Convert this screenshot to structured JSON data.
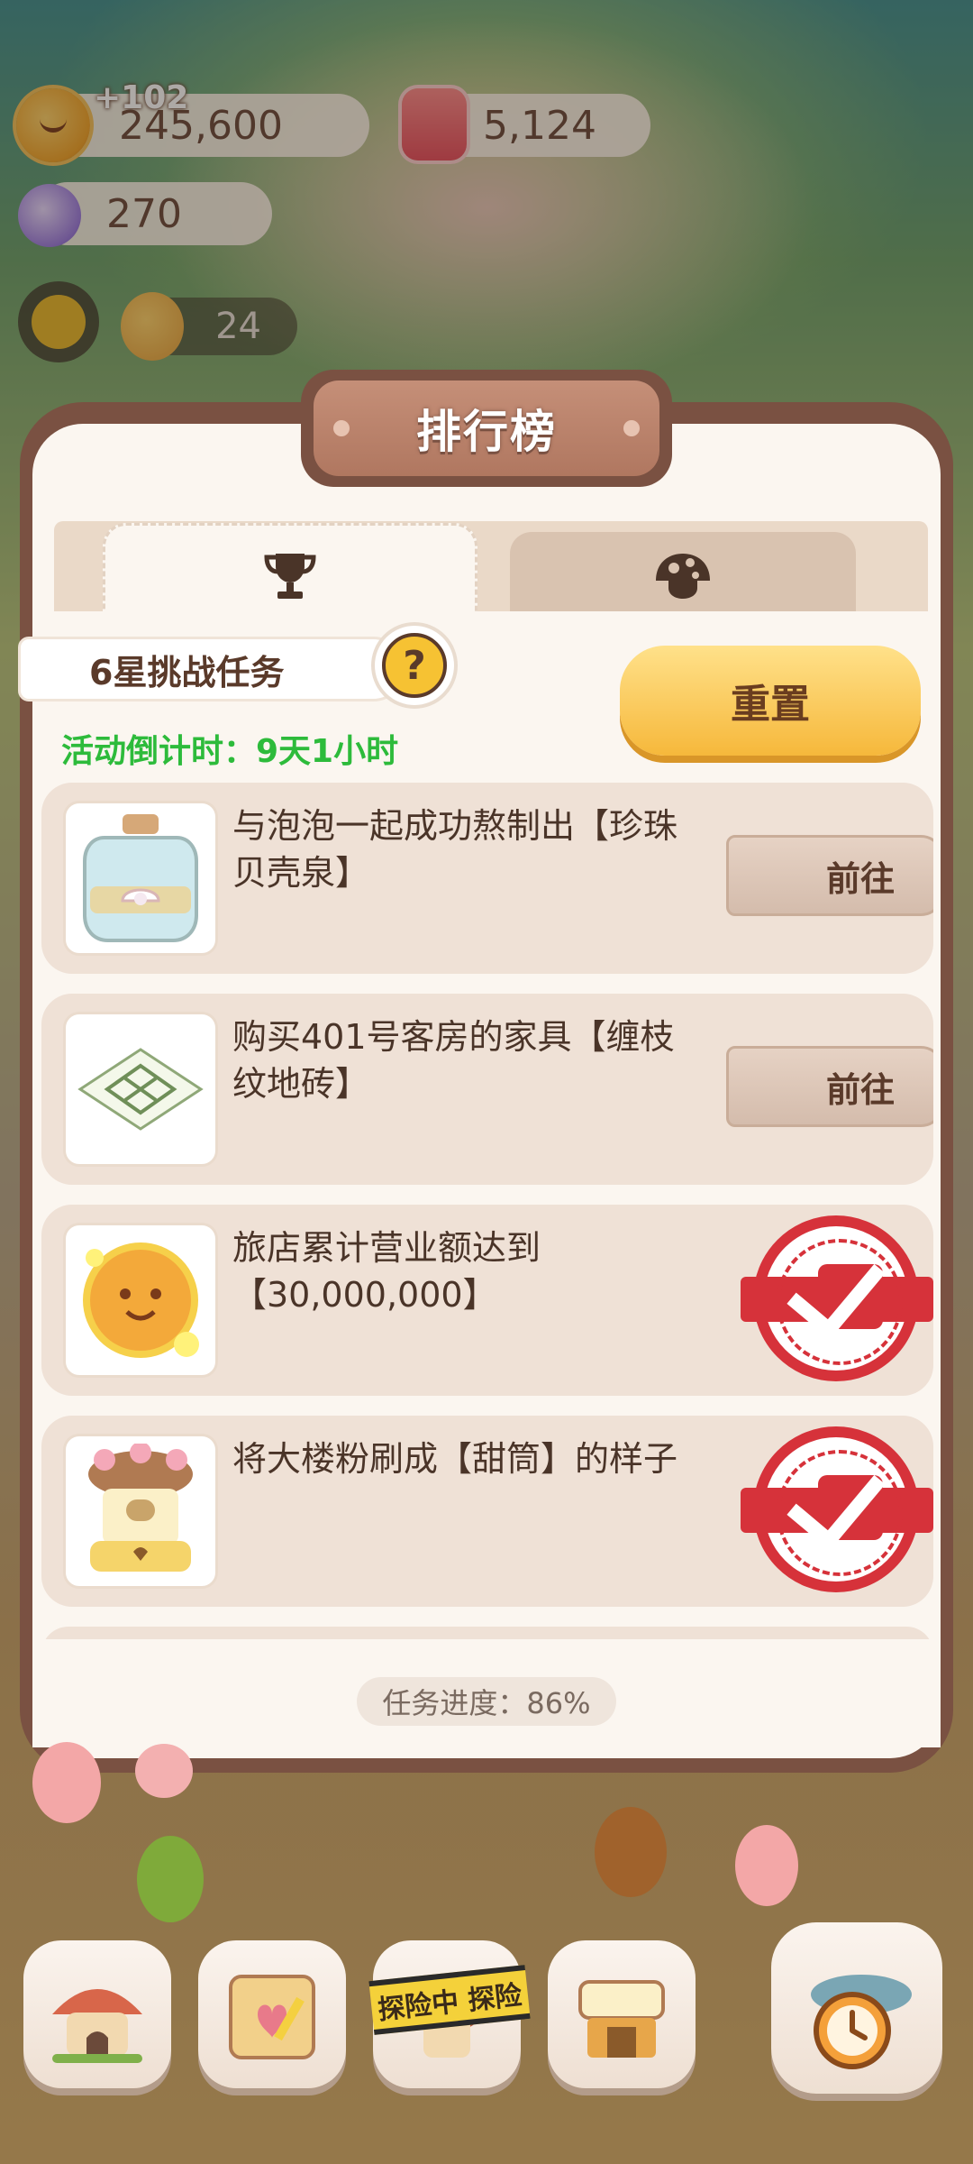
{
  "resources": {
    "coins": "245,600",
    "coins_gain": "+102",
    "gems": "5,124",
    "candy": "270",
    "workers": "24"
  },
  "panel": {
    "title": "排行榜",
    "tabs": [
      {
        "name": "trophy",
        "icon": "trophy-icon",
        "active": true
      },
      {
        "name": "mushroom",
        "icon": "mushroom-icon",
        "active": false
      }
    ],
    "challenge_label": "6星挑战任务",
    "help_glyph": "?",
    "reset_label": "重置",
    "countdown": "活动倒计时：9天1小时",
    "tasks": [
      {
        "text": "与泡泡一起成功熬制出【珍珠贝壳泉】",
        "action": "前往",
        "done": false,
        "icon": "pearl-jar-icon"
      },
      {
        "text": "购买401号客房的家具【缠枝纹地砖】",
        "action": "前往",
        "done": false,
        "icon": "floor-tile-icon"
      },
      {
        "text": "旅店累计营业额达到【30,000,000】",
        "action": "",
        "done": true,
        "icon": "cookie-coin-icon"
      },
      {
        "text": "将大楼粉刷成【甜筒】的样子",
        "action": "",
        "done": true,
        "icon": "building-icon"
      }
    ],
    "progress": "任务进度：86%"
  },
  "bottom_bar": {
    "explore_tape": "探险中 探险",
    "buttons": [
      "house-icon",
      "calendar-icon",
      "explore-icon",
      "shop-icon",
      "clock-icon"
    ]
  },
  "colors": {
    "panel_border": "#7a5142",
    "panel_bg": "#fbf6f0",
    "accent_green": "#2dbb3b",
    "reset_yellow": "#f6b83b",
    "stamp_red": "#d6323a"
  }
}
